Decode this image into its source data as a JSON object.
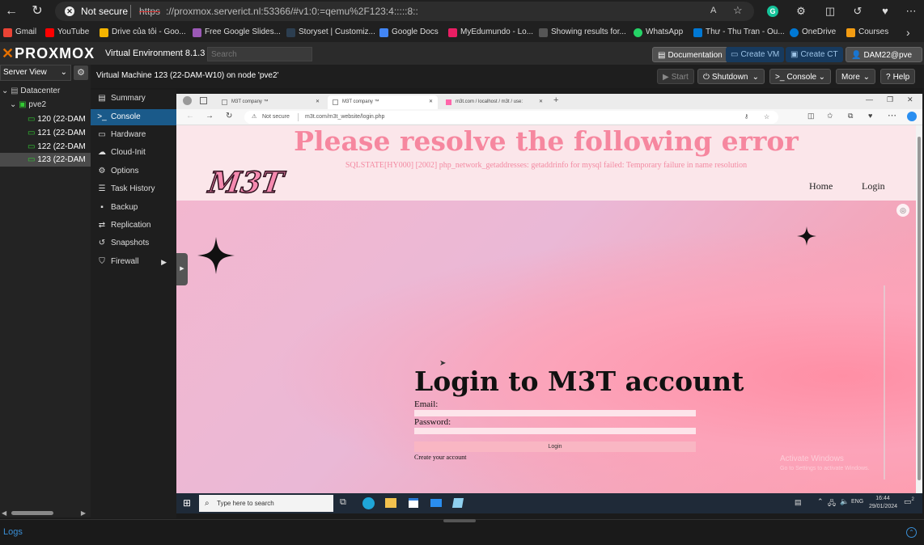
{
  "browser": {
    "security": "Not secure",
    "url_protocol": "https",
    "url_rest": "://proxmox.serverict.nl:53366/#v1:0:=qemu%2F123:4:::::8::",
    "zoom_icon": "A",
    "bookmarks": [
      {
        "label": "Gmail",
        "color": "#ea4335"
      },
      {
        "label": "YouTube",
        "color": "#ff0000"
      },
      {
        "label": "Drive của tôi - Goo...",
        "color": "#f4b400"
      },
      {
        "label": "Free Google Slides...",
        "color": "#9b59b6"
      },
      {
        "label": "Storyset | Customiz...",
        "color": "#2c3e50"
      },
      {
        "label": "Google Docs",
        "color": "#4285f4"
      },
      {
        "label": "MyEdumundo - Lo...",
        "color": "#e91e63"
      },
      {
        "label": "Showing results for...",
        "color": "#555555"
      },
      {
        "label": "WhatsApp",
        "color": "#25d366"
      },
      {
        "label": "Thư - Thu Tran - Ou...",
        "color": "#0078d4"
      },
      {
        "label": "OneDrive",
        "color": "#0078d4"
      },
      {
        "label": "Courses",
        "color": "#f39c12"
      }
    ],
    "more_bookmarks_icon": "›"
  },
  "proxmox": {
    "logo": "PROXMOX",
    "version": "Virtual Environment 8.1.3",
    "search_placeholder": "Search",
    "buttons": {
      "documentation": "Documentation",
      "create_vm": "Create VM",
      "create_ct": "Create CT",
      "user": "DAM22@pve"
    },
    "server_view": "Server View",
    "tree": {
      "datacenter": "Datacenter",
      "node": "pve2",
      "vms": [
        "120 (22-DAM",
        "121 (22-DAM",
        "122 (22-DAM",
        "123 (22-DAM"
      ]
    },
    "vm_title": "Virtual Machine 123 (22-DAM-W10) on node 'pve2'",
    "actions": {
      "start": "Start",
      "shutdown": "Shutdown",
      "console": "Console",
      "more": "More",
      "help": "Help"
    },
    "menu": [
      "Summary",
      "Console",
      "Hardware",
      "Cloud-Init",
      "Options",
      "Task History",
      "Backup",
      "Replication",
      "Snapshots",
      "Firewall"
    ],
    "logs_label": "Logs"
  },
  "guest_browser": {
    "tabs": [
      "M3T company ™",
      "M3T company ™",
      "m3t.com / localhost / m3t / use:"
    ],
    "security": "Not secure",
    "url": "m3t.com/m3t_website/login.php"
  },
  "website": {
    "error_title": "Please resolve the following error",
    "error_detail": "SQLSTATE[HY000] [2002] php_network_getaddresses: getaddrinfo for mysql failed: Temporary failure in name resolution",
    "logo": "M3T",
    "nav": [
      "Home",
      "Login"
    ],
    "login_title": "Login to M3T account",
    "email_label": "Email:",
    "password_label": "Password:",
    "login_button": "Login",
    "create_account": "Create your account",
    "watermark_title": "Activate Windows",
    "watermark_sub": "Go to Settings to activate Windows."
  },
  "taskbar": {
    "search_placeholder": "Type here to search",
    "lang": "ENG",
    "time": "16:44",
    "date": "29/01/2024",
    "notifications": "2"
  }
}
